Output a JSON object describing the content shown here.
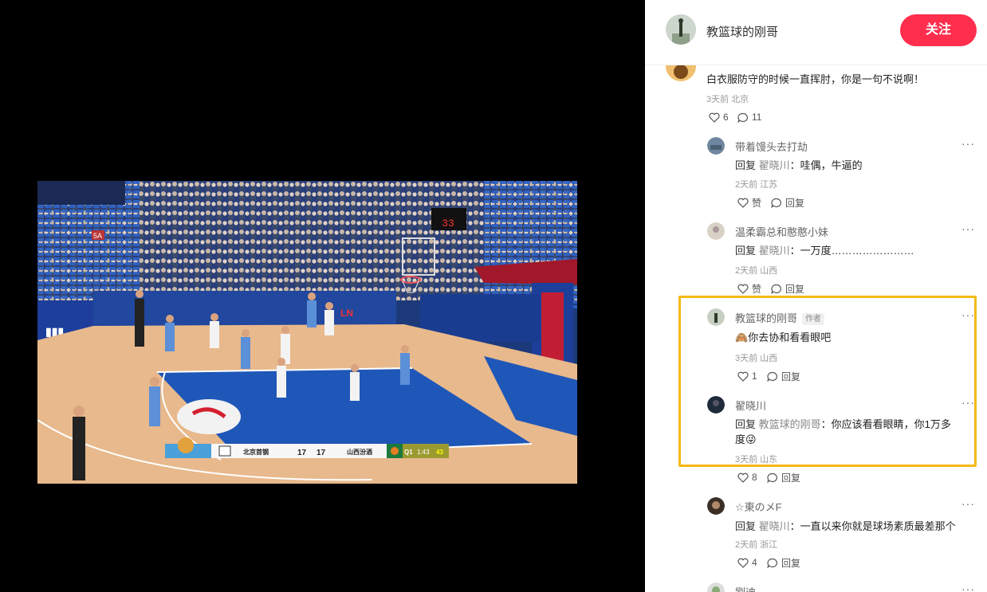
{
  "author": {
    "name": "教篮球的刚哥",
    "follow_label": "关注"
  },
  "scoreboard": {
    "home_team": "北京首钢",
    "home_score": "17",
    "away_score": "17",
    "away_team": "山西汾酒",
    "period": "Q1",
    "clock": "1:43",
    "shot_clock": "43",
    "arena_shot_clock": "33",
    "zone_sign": "5A"
  },
  "comments": [
    {
      "text": "白衣服防守的时候一直挥肘，你是一句不说啊！",
      "meta": "3天前 北京",
      "likes": "6",
      "replies": "11",
      "icons": [
        "heart-icon",
        "comment-icon"
      ]
    }
  ],
  "replies": [
    {
      "user": "带着馒头去打劫",
      "reply_label": "回复",
      "mention": "翟晓川",
      "text": "：哇偶，牛逼的",
      "meta": "2天前 江苏",
      "like_label": "赞",
      "reply_action": "回复"
    },
    {
      "user": "温柔霸总和憨憨小妹",
      "reply_label": "回复",
      "mention": "翟晓川",
      "text": "：一万度……………………",
      "meta": "2天前 山西",
      "like_label": "赞",
      "reply_action": "回复"
    },
    {
      "user": "教篮球的刚哥",
      "author_tag": "作者",
      "emoji": "🙈",
      "text": "你去协和看看眼吧",
      "meta": "3天前 山西",
      "likes": "1",
      "reply_action": "回复"
    },
    {
      "user": "翟晓川",
      "reply_label": "回复",
      "mention": "教篮球的刚哥",
      "text_line1": "：你应该看看眼睛，你1万多",
      "text_line2": "度",
      "emoji": "😜",
      "meta": "3天前 山东",
      "likes": "8",
      "reply_action": "回复"
    },
    {
      "user": "☆東のメF",
      "reply_label": "回复",
      "mention": "翟晓川",
      "text": "：一直以来你就是球场素质最差那个",
      "meta": "2天前 浙江",
      "likes": "4",
      "reply_action": "回复"
    },
    {
      "user": "劉迪"
    }
  ],
  "more_label": "···",
  "colors": {
    "follow_button": "#ff2e4d",
    "highlight": "#f5b915",
    "court_blue": "#1f57b8",
    "court_wood": "#e8b98c"
  }
}
